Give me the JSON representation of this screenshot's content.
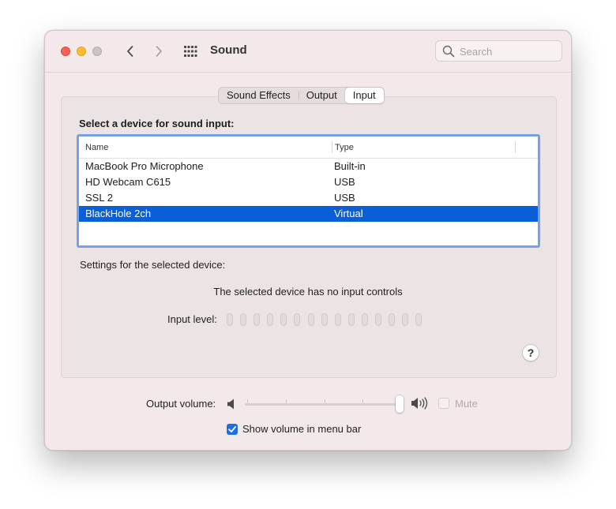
{
  "window": {
    "title": "Sound"
  },
  "search": {
    "placeholder": "Search"
  },
  "tabs": [
    {
      "label": "Sound Effects",
      "active": false
    },
    {
      "label": "Output",
      "active": false
    },
    {
      "label": "Input",
      "active": true
    }
  ],
  "input_panel": {
    "select_label": "Select a device for sound input:",
    "columns": {
      "name": "Name",
      "type": "Type"
    },
    "devices": [
      {
        "name": "MacBook Pro Microphone",
        "type": "Built-in"
      },
      {
        "name": "HD Webcam C615",
        "type": "USB"
      },
      {
        "name": "SSL 2",
        "type": "USB"
      },
      {
        "name": "BlackHole 2ch",
        "type": "Virtual",
        "selected": true
      }
    ],
    "settings_label": "Settings for the selected device:",
    "no_controls_text": "The selected device has no input controls",
    "input_level_label": "Input level:",
    "input_level_value": 0,
    "input_level_segments": 15,
    "help_label": "?"
  },
  "footer": {
    "output_volume_label": "Output volume:",
    "output_volume_value": 1.0,
    "mute_label": "Mute",
    "mute_checked": false,
    "mute_enabled": false,
    "show_volume_label": "Show volume in menu bar",
    "show_volume_checked": true
  },
  "colors": {
    "window_bg": "#f3e9ea",
    "selection": "#0a5fd6",
    "focus_ring": "#76a1e6",
    "close": "#fe5f57",
    "minimize": "#febc2e",
    "accent": "#1c6fe3"
  }
}
